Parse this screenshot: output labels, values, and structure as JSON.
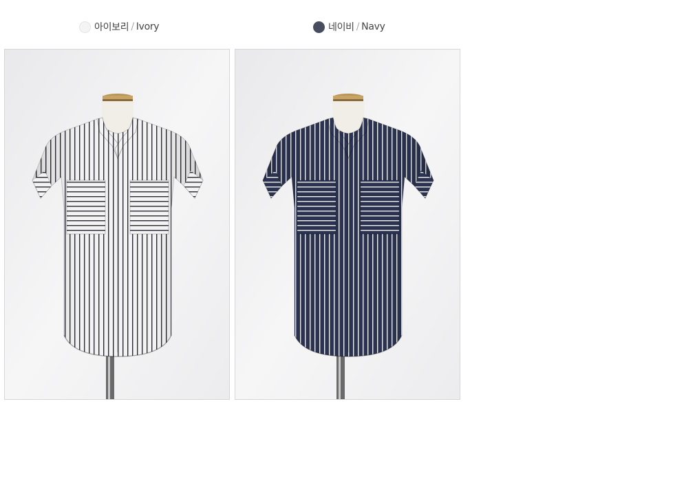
{
  "variants": [
    {
      "name_ko": "아이보리",
      "separator": "/",
      "name_en": "Ivory",
      "swatch_color": "#f4f4f4",
      "swatch_border": "#e4e4e4",
      "shirt_color": "#f3f3f3",
      "stripe_color": "#2b2b35",
      "icon": "garment-photo"
    },
    {
      "name_ko": "네이비",
      "separator": "/",
      "name_en": "Navy",
      "swatch_color": "#474d5e",
      "swatch_border": "#474d5e",
      "shirt_color": "#2b3350",
      "stripe_color": "#f1f1f1",
      "icon": "garment-photo"
    }
  ]
}
